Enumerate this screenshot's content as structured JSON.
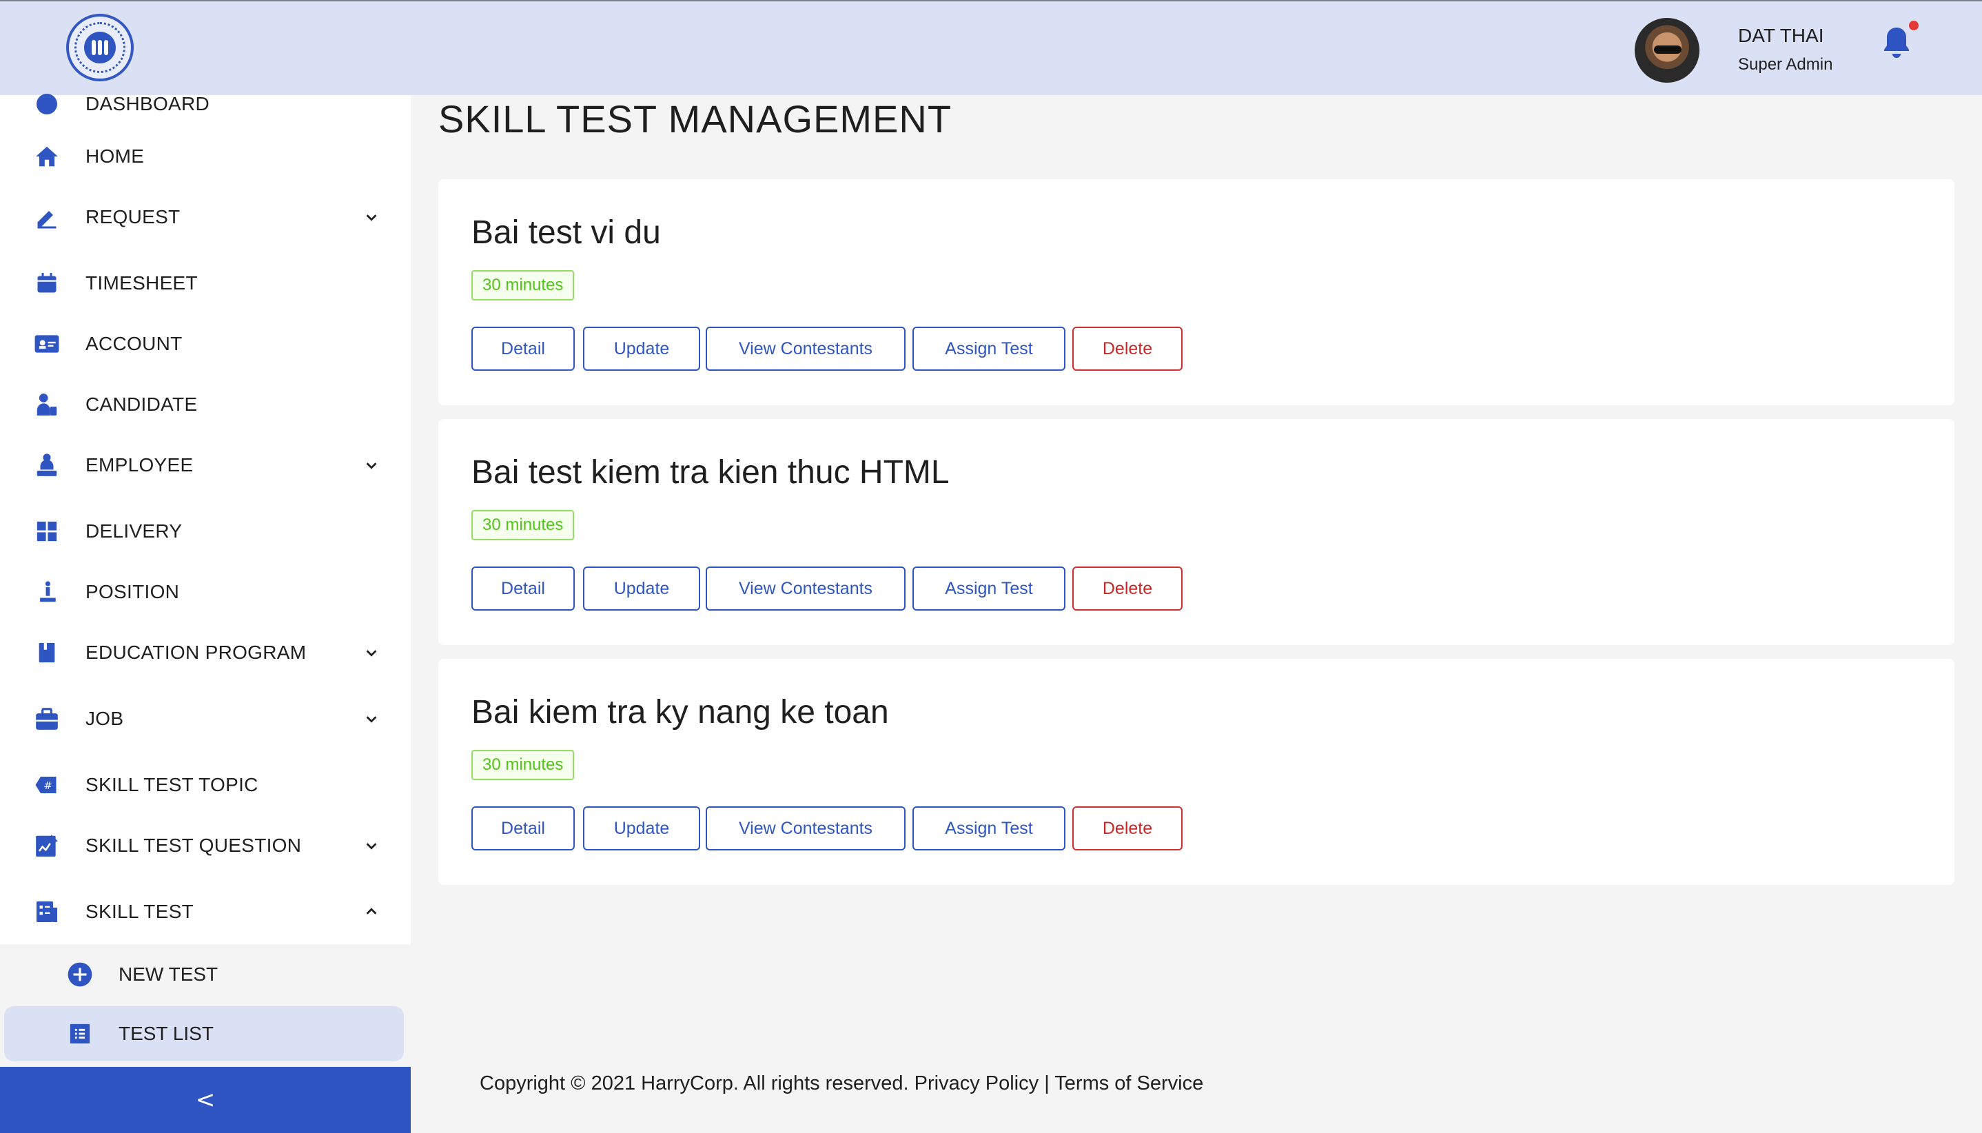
{
  "header": {
    "user_name": "DAT THAI",
    "user_role": "Super Admin"
  },
  "sidebar": {
    "items": [
      {
        "label": "DASHBOARD",
        "icon": "dashboard-icon"
      },
      {
        "label": "HOME",
        "icon": "home-icon"
      },
      {
        "label": "REQUEST",
        "icon": "pencil-icon",
        "expandable": true
      },
      {
        "label": "TIMESHEET",
        "icon": "calendar-icon"
      },
      {
        "label": "ACCOUNT",
        "icon": "id-card-icon"
      },
      {
        "label": "CANDIDATE",
        "icon": "candidate-icon"
      },
      {
        "label": "EMPLOYEE",
        "icon": "employee-icon",
        "expandable": true
      },
      {
        "label": "DELIVERY",
        "icon": "grid-icon"
      },
      {
        "label": "POSITION",
        "icon": "position-icon"
      },
      {
        "label": "EDUCATION PROGRAM",
        "icon": "book-icon",
        "expandable": true
      },
      {
        "label": "JOB",
        "icon": "briefcase-icon",
        "expandable": true
      },
      {
        "label": "SKILL TEST TOPIC",
        "icon": "hashtag-icon"
      },
      {
        "label": "SKILL TEST QUESTION",
        "icon": "question-doc-icon",
        "expandable": true
      },
      {
        "label": "SKILL TEST",
        "icon": "test-doc-icon",
        "expanded": true
      }
    ],
    "sub_items": [
      {
        "label": "NEW TEST",
        "icon": "plus-circle-icon"
      },
      {
        "label": "TEST LIST",
        "icon": "list-icon",
        "active": true
      }
    ],
    "collapse_glyph": "<"
  },
  "main": {
    "title": "SKILL TEST MANAGEMENT",
    "tests": [
      {
        "name": "Bai test vi du",
        "duration": "30 minutes"
      },
      {
        "name": "Bai test kiem tra kien thuc HTML",
        "duration": "30 minutes"
      },
      {
        "name": "Bai kiem tra ky nang ke toan",
        "duration": "30 minutes"
      }
    ],
    "actions": {
      "detail": "Detail",
      "update": "Update",
      "view_contestants": "View Contestants",
      "assign_test": "Assign Test",
      "delete": "Delete"
    }
  },
  "footer": {
    "copyright": "Copyright © 2021 HarryCorp. All rights reserved.",
    "privacy": "Privacy Policy",
    "separator": "|",
    "terms": "Terms of Service"
  },
  "colors": {
    "brand": "#2f55c2",
    "header_bg": "#dbe1f5",
    "danger": "#c62828",
    "badge_green": "#52c41a"
  }
}
